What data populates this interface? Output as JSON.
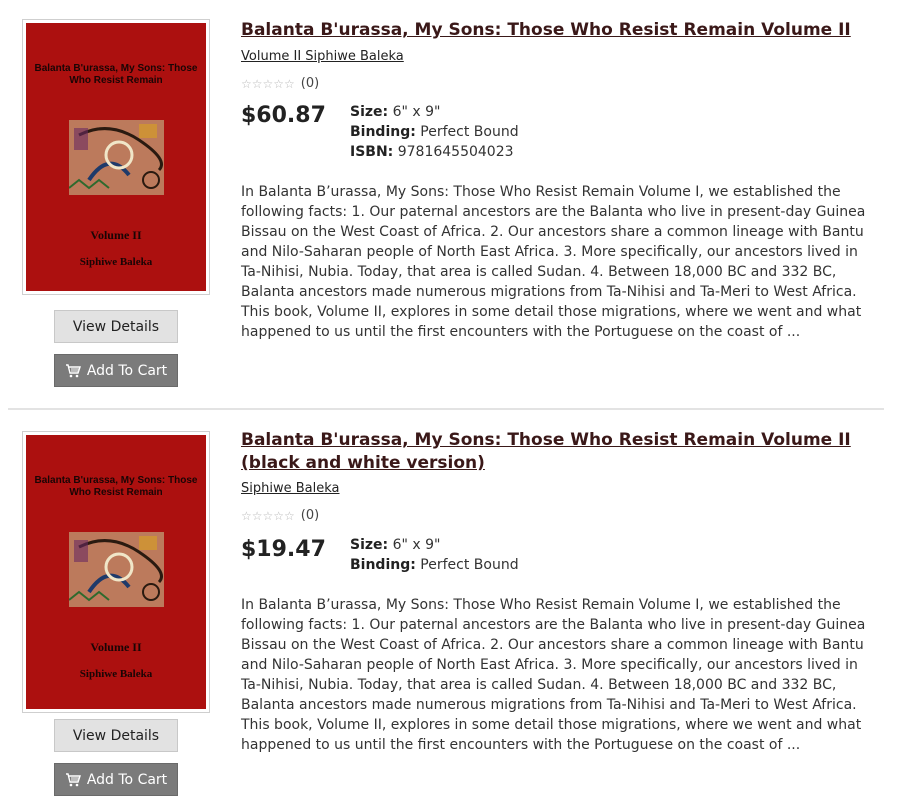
{
  "products": [
    {
      "title": "Balanta B'urassa, My Sons: Those Who Resist Remain Volume II",
      "author": "Volume II Siphiwe Baleka",
      "rating_count": "(0)",
      "rating_value": 0,
      "price": "$60.87",
      "specs": {
        "size_label": "Size:",
        "size_value": "6\" x 9\"",
        "binding_label": "Binding:",
        "binding_value": "Perfect Bound",
        "isbn_label": "ISBN:",
        "isbn_value": "9781645504023"
      },
      "description": "In Balanta B’urassa, My Sons: Those Who Resist Remain Volume I, we established the following facts: 1. Our paternal ancestors are the Balanta who live in present-day Guinea Bissau on the West Coast of Africa. 2. Our ancestors share a common lineage with Bantu and Nilo-Saharan people of North East Africa. 3. More specifically, our ancestors lived in Ta-Nihisi, Nubia. Today, that area is called Sudan. 4. Between 18,000 BC and 332 BC, Balanta ancestors made numerous migrations from Ta-Nihisi and Ta-Meri to West Africa. This book, Volume II, explores in some detail those migrations, where we went and what happened to us until the first encounters with the Portuguese on the coast of ...",
      "cover": {
        "title": "Balanta B'urassa, My Sons: Those Who Resist Remain",
        "volume": "Volume II",
        "author": "Siphiwe Baleka"
      },
      "view_label": "View Details",
      "cart_label": "Add To Cart"
    },
    {
      "title": "Balanta B'urassa, My Sons: Those Who Resist Remain Volume II (black and white version)",
      "author": "Siphiwe Baleka",
      "rating_count": "(0)",
      "rating_value": 0,
      "price": "$19.47",
      "specs": {
        "size_label": "Size:",
        "size_value": "6\" x 9\"",
        "binding_label": "Binding:",
        "binding_value": "Perfect Bound"
      },
      "description": "In Balanta B’urassa, My Sons: Those Who Resist Remain Volume I, we established the following facts: 1. Our paternal ancestors are the Balanta who live in present-day Guinea Bissau on the West Coast of Africa. 2. Our ancestors share a common lineage with Bantu and Nilo-Saharan people of North East Africa. 3. More specifically, our ancestors lived in Ta-Nihisi, Nubia. Today, that area is called Sudan. 4. Between 18,000 BC and 332 BC, Balanta ancestors made numerous migrations from Ta-Nihisi and Ta-Meri to West Africa. This book, Volume II, explores in some detail those migrations, where we went and what happened to us until the first encounters with the Portuguese on the coast of ...",
      "cover": {
        "title": "Balanta B'urassa, My Sons: Those Who Resist Remain",
        "volume": "Volume II",
        "author": "Siphiwe Baleka"
      },
      "view_label": "View Details",
      "cart_label": "Add To Cart"
    }
  ],
  "icons": {
    "rating": "star-icon",
    "cart": "shopping-cart-icon"
  },
  "colors": {
    "cover_red": "#ac100f",
    "title_link": "#3a1818",
    "cart_button": "#7b7b7b",
    "view_button": "#e2e2e2"
  }
}
